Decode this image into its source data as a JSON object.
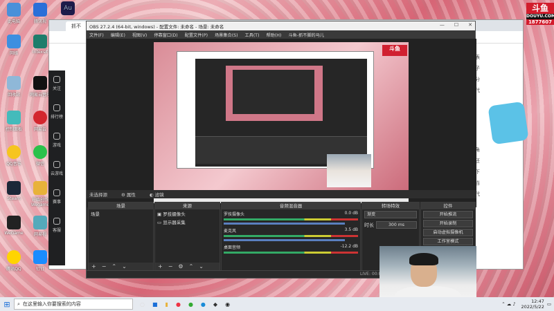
{
  "desktop": {
    "icons": [
      "此电脑",
      "腾讯视",
      "Au",
      "",
      "",
      "网络",
      "Intexsit",
      "回收站",
      "网易云音乐",
      "控制面板",
      "网易云",
      "QQ音乐",
      "微信",
      "Steam",
      "开始创作 Wegame",
      "WeGame",
      "网易视",
      "腾讯QQ",
      "钉钉"
    ]
  },
  "brand": {
    "logo": "斗鱼",
    "site": "DOUYU.COM",
    "room": "1877607"
  },
  "browser": {
    "tab_label": "抓不",
    "right_text": [
      "表",
      "子",
      "分",
      "代",
      "",
      "角",
      "还",
      "下",
      "当",
      "代"
    ]
  },
  "left_sidebar": {
    "items": [
      "关注",
      "排行榜",
      "游戏",
      "云游戏",
      "赛事",
      "客服"
    ]
  },
  "obs": {
    "title": "OBS 27.2.4 (64-bit, windows) - 配置文件: 未命名 - 场景: 未命名",
    "menu": [
      "文件(F)",
      "编辑(E)",
      "视图(V)",
      "停靠窗口(D)",
      "配置文件(P)",
      "场景集合(S)",
      "工具(T)",
      "帮助(H)",
      "斗鱼-抓不脚的马儿"
    ],
    "preview_logo": "斗鱼",
    "source_bar": {
      "label": "未选择源",
      "properties": "属性",
      "filters": "滤镜"
    },
    "docks": {
      "scenes": {
        "title": "场景",
        "items": [
          "场景"
        ]
      },
      "sources": {
        "title": "来源",
        "items": [
          "罗技摄像头",
          "显示器采集"
        ]
      },
      "mixer": {
        "title": "音频混音器",
        "channels": [
          {
            "name": "罗技摄像头",
            "db": "0.0 dB"
          },
          {
            "name": "麦克风",
            "db": "3.5 dB"
          },
          {
            "name": "桌面音频",
            "db": "-12.2 dB"
          }
        ]
      },
      "transitions": {
        "title": "转场特效",
        "type": "渐变",
        "duration_label": "时长",
        "duration": "300 ms"
      },
      "controls": {
        "title": "控件",
        "buttons": [
          "开始推流",
          "开始录制",
          "启动虚拟摄像机",
          "工作室模式",
          "设置"
        ]
      }
    },
    "status": "LIVE: 00:00:00   REC: 00:00:00   CPU: 3.4%, 60.00 fps"
  },
  "taskbar": {
    "search_placeholder": "在这里输入你要搜索的内容",
    "time": "12:47",
    "date": "2022/5/22"
  }
}
